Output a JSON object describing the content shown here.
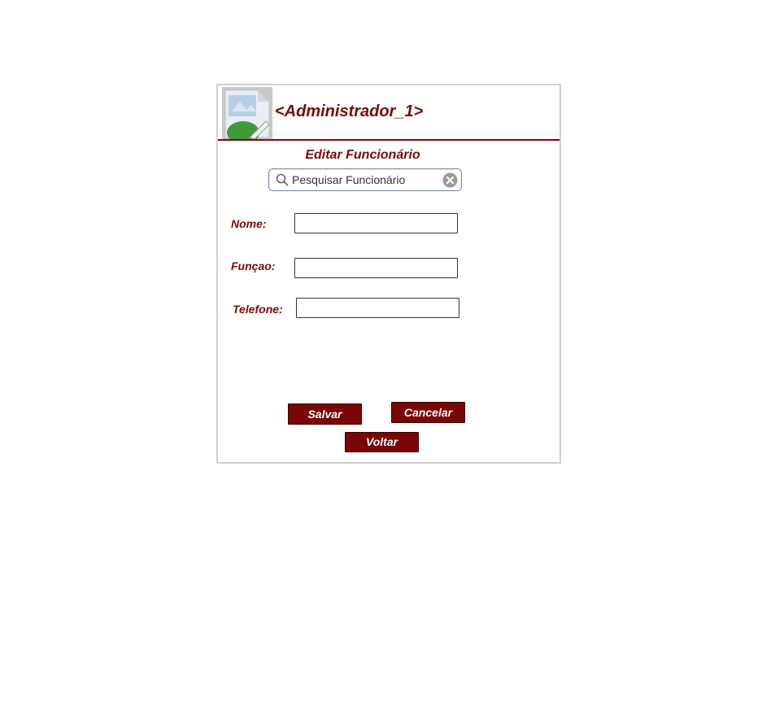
{
  "header": {
    "title": "<Administrador_1>",
    "avatar_icon": "image-placeholder-icon"
  },
  "form": {
    "title": "Editar Funcionário",
    "search": {
      "placeholder": "Pesquisar Funcionário",
      "value": ""
    },
    "fields": {
      "nome_label": "Nome:",
      "nome_value": "",
      "funcao_label": "Funçao:",
      "funcao_value": "",
      "telefone_label": "Telefone:",
      "telefone_value": ""
    }
  },
  "buttons": {
    "salvar": "Salvar",
    "cancelar": "Cancelar",
    "voltar": "Voltar"
  },
  "colors": {
    "accent": "#7a0a0a",
    "button_bg": "#7a0606",
    "border": "#cfcfcf"
  }
}
